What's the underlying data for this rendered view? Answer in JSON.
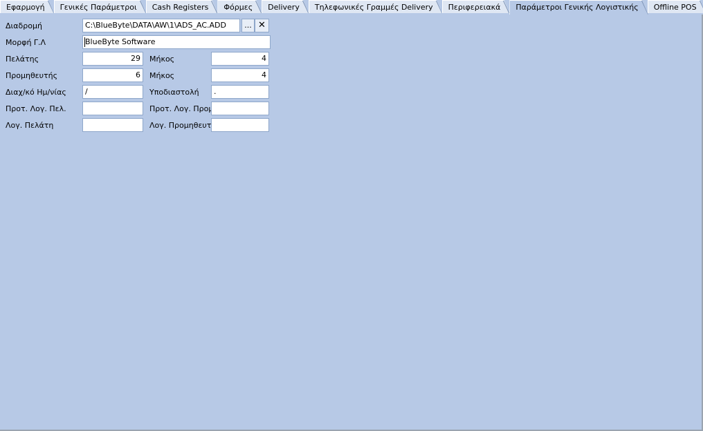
{
  "window": {
    "background_color": "#b7c9e6",
    "field_background": "#ffffff",
    "field_border": "#8ea7ca",
    "tab_inactive_color": "#dfe7f3"
  },
  "tabs": [
    {
      "label": "Εφαρμογή",
      "active": false
    },
    {
      "label": "Γενικές Παράμετροι",
      "active": false
    },
    {
      "label": "Cash Registers",
      "active": false
    },
    {
      "label": "Φόρμες",
      "active": false
    },
    {
      "label": "Delivery",
      "active": false
    },
    {
      "label": "Τηλεφωνικές Γραμμές Delivery",
      "active": false
    },
    {
      "label": "Περιφερειακά",
      "active": false
    },
    {
      "label": "Παράμετροι Γενικής Λογιστικής",
      "active": true
    },
    {
      "label": "Offline POS",
      "active": false
    }
  ],
  "form": {
    "rows": [
      {
        "label_left": "Διαδρομή",
        "value_left": "C:\\BlueByte\\DATA\\AW\\1\\ADS_AC.ADD",
        "browse_button": "...",
        "clear_button": "✕"
      },
      {
        "label_left": "Μορφή Γ.Λ",
        "value_left": "BlueByte Software",
        "dropdown_icon": "chevron-down-icon"
      },
      {
        "label_left": "Πελάτης",
        "value_left": "29",
        "label_right": "Μήκος",
        "value_right": "4"
      },
      {
        "label_left": "Προμηθευτής",
        "value_left": "6",
        "label_right": "Μήκος",
        "value_right": "4"
      },
      {
        "label_left": "Διαχ/κό Ημ/νίας",
        "value_left": "/",
        "label_right": "Υποδιαστολή",
        "value_right": "."
      },
      {
        "label_left": "Προτ. Λογ. Πελ.",
        "value_left": "",
        "label_right": "Προτ. Λογ. Προμ",
        "value_right": ""
      },
      {
        "label_left": "Λογ. Πελάτη",
        "value_left": "",
        "label_right": "Λογ. Προμηθευτή",
        "value_right": ""
      }
    ]
  }
}
